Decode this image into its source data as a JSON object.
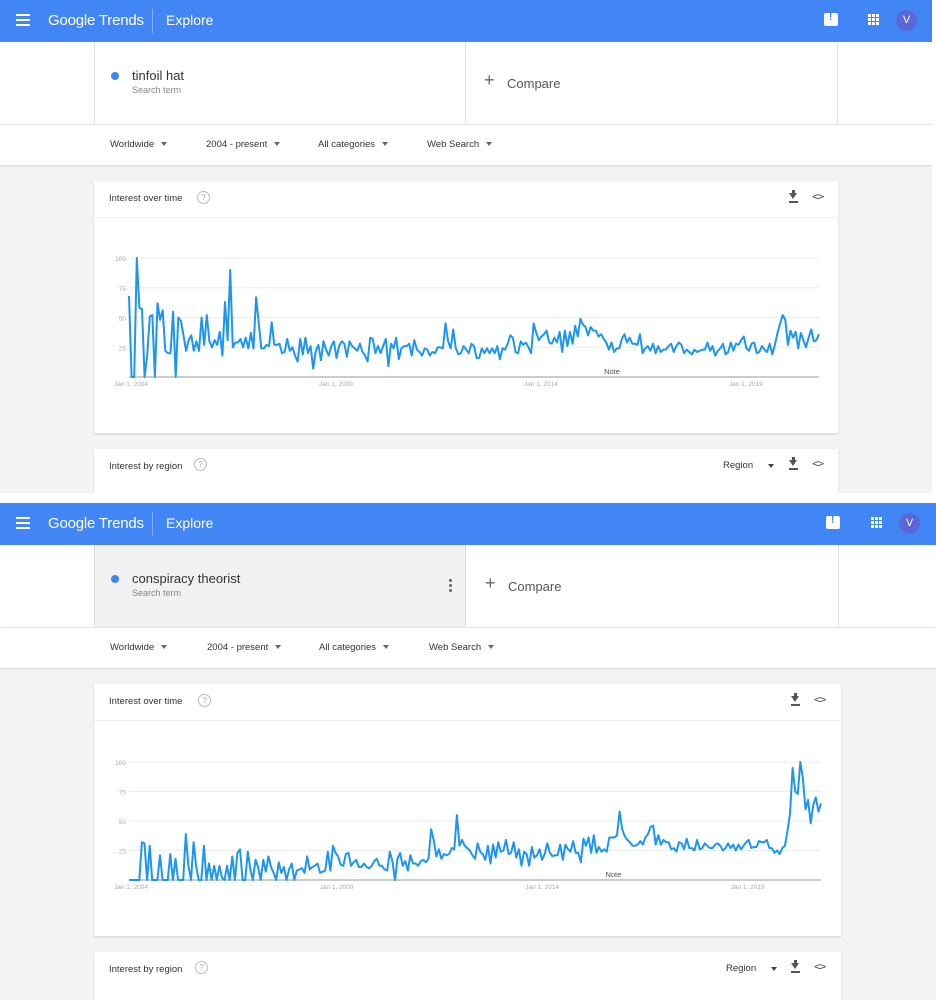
{
  "colors": {
    "brand_blue": "#4285f4",
    "series_blue": "#1e96f0",
    "avatar": "#5a67d8"
  },
  "header": {
    "logo": "Google Trends",
    "explore": "Explore",
    "avatar_letter": "V"
  },
  "compare_label": "Compare",
  "filters": {
    "region": "Worldwide",
    "time": "2004 - present",
    "category": "All categories",
    "property": "Web Search"
  },
  "cards": {
    "interest_over_time": "Interest over time",
    "interest_by_region": "Interest by region",
    "region_select": "Region"
  },
  "icons": {
    "menu": "menu-icon",
    "feedback": "feedback-icon",
    "apps": "apps-icon",
    "help": "help-icon",
    "download": "download-icon",
    "embed": "embed-icon",
    "more": "more-vert-icon",
    "add": "plus-icon"
  },
  "panels": [
    {
      "term": "tinfoil hat",
      "term_sub": "Search term"
    },
    {
      "term": "conspiracy theorist",
      "term_sub": "Search term"
    }
  ],
  "chart_data": [
    {
      "type": "line",
      "title": "Interest over time",
      "series": [
        {
          "name": "tinfoil hat",
          "values": [
            68,
            0,
            0,
            100,
            58,
            57,
            0,
            18,
            51,
            52,
            0,
            62,
            48,
            56,
            22,
            20,
            20,
            55,
            0,
            50,
            47,
            35,
            22,
            31,
            35,
            22,
            30,
            22,
            50,
            27,
            52,
            30,
            25,
            31,
            27,
            38,
            18,
            63,
            31,
            90,
            25,
            29,
            29,
            32,
            25,
            33,
            24,
            37,
            24,
            67,
            46,
            24,
            24,
            27,
            26,
            46,
            27,
            27,
            28,
            20,
            21,
            32,
            22,
            25,
            18,
            13,
            32,
            19,
            33,
            20,
            26,
            7,
            22,
            27,
            14,
            30,
            23,
            18,
            26,
            30,
            16,
            26,
            30,
            28,
            17,
            30,
            26,
            24,
            22,
            28,
            21,
            18,
            13,
            33,
            32,
            20,
            26,
            20,
            26,
            32,
            9,
            28,
            24,
            33,
            15,
            24,
            26,
            26,
            28,
            18,
            31,
            23,
            21,
            18,
            24,
            23,
            18,
            21,
            20,
            25,
            25,
            24,
            45,
            30,
            24,
            40,
            24,
            19,
            20,
            26,
            23,
            20,
            28,
            26,
            16,
            16,
            24,
            20,
            24,
            20,
            24,
            20,
            26,
            15,
            24,
            23,
            28,
            35,
            33,
            21,
            20,
            30,
            27,
            29,
            25,
            20,
            45,
            37,
            31,
            34,
            36,
            39,
            29,
            28,
            33,
            29,
            38,
            21,
            39,
            26,
            38,
            28,
            43,
            34,
            49,
            44,
            42,
            35,
            42,
            39,
            39,
            34,
            36,
            32,
            29,
            23,
            29,
            21,
            24,
            24,
            32,
            36,
            29,
            33,
            28,
            28,
            27,
            36,
            20,
            24,
            26,
            22,
            28,
            20,
            26,
            21,
            23,
            23,
            26,
            28,
            21,
            26,
            29,
            27,
            20,
            23,
            21,
            19,
            23,
            21,
            22,
            23,
            23,
            29,
            22,
            26,
            18,
            22,
            24,
            28,
            19,
            21,
            29,
            22,
            28,
            27,
            31,
            34,
            24,
            22,
            28,
            29,
            20,
            21,
            26,
            23,
            21,
            28,
            19,
            27,
            37,
            45,
            52,
            48,
            27,
            39,
            33,
            38,
            24,
            37,
            31,
            25,
            33,
            40,
            30,
            31,
            36
          ]
        }
      ],
      "x_ticks": [
        "Jan 1, 2004",
        "Jan 1, 2009",
        "Jan 1, 2014",
        "Jan 1, 2019"
      ],
      "y_ticks": [
        25,
        50,
        75,
        100
      ],
      "ylim": [
        0,
        100
      ],
      "note": "Note"
    },
    {
      "type": "line",
      "title": "Interest over time",
      "series": [
        {
          "name": "conspiracy theorist",
          "values": [
            0,
            0,
            0,
            0,
            0,
            32,
            31,
            0,
            29,
            0,
            0,
            0,
            21,
            0,
            0,
            0,
            22,
            0,
            18,
            0,
            0,
            0,
            39,
            12,
            0,
            32,
            12,
            0,
            0,
            29,
            0,
            14,
            0,
            12,
            0,
            12,
            2,
            0,
            12,
            0,
            20,
            0,
            23,
            26,
            0,
            0,
            24,
            9,
            0,
            17,
            11,
            0,
            17,
            7,
            20,
            11,
            6,
            0,
            15,
            6,
            11,
            0,
            9,
            14,
            0,
            8,
            9,
            10,
            6,
            20,
            9,
            11,
            12,
            14,
            6,
            7,
            8,
            24,
            8,
            29,
            23,
            20,
            13,
            12,
            22,
            23,
            12,
            15,
            17,
            11,
            11,
            14,
            11,
            10,
            12,
            16,
            18,
            12,
            12,
            9,
            8,
            24,
            16,
            0,
            18,
            23,
            12,
            16,
            8,
            21,
            14,
            14,
            12,
            16,
            17,
            15,
            18,
            43,
            34,
            20,
            26,
            18,
            22,
            21,
            22,
            27,
            26,
            55,
            29,
            34,
            29,
            27,
            25,
            21,
            18,
            31,
            24,
            22,
            17,
            29,
            14,
            30,
            19,
            32,
            24,
            25,
            34,
            22,
            23,
            32,
            19,
            26,
            12,
            24,
            22,
            12,
            28,
            19,
            21,
            26,
            17,
            22,
            31,
            23,
            20,
            21,
            21,
            30,
            17,
            30,
            26,
            24,
            33,
            23,
            23,
            15,
            35,
            29,
            36,
            23,
            38,
            23,
            28,
            24,
            26,
            24,
            36,
            36,
            36,
            38,
            58,
            43,
            37,
            34,
            32,
            29,
            29,
            30,
            33,
            30,
            36,
            39,
            45,
            46,
            30,
            38,
            30,
            34,
            32,
            32,
            26,
            27,
            24,
            32,
            31,
            26,
            35,
            27,
            27,
            25,
            34,
            26,
            27,
            31,
            29,
            27,
            27,
            30,
            31,
            29,
            25,
            27,
            31,
            27,
            30,
            25,
            30,
            26,
            29,
            32,
            34,
            27,
            28,
            28,
            33,
            32,
            32,
            34,
            27,
            27,
            23,
            25,
            22,
            27,
            29,
            41,
            56,
            95,
            75,
            73,
            100,
            86,
            60,
            68,
            48,
            64,
            70,
            58,
            65
          ]
        }
      ],
      "x_ticks": [
        "Jan 1, 2004",
        "Jan 1, 2009",
        "Jan 1, 2014",
        "Jan 1, 2019"
      ],
      "y_ticks": [
        25,
        50,
        75,
        100
      ],
      "ylim": [
        0,
        100
      ],
      "note": "Note"
    }
  ]
}
